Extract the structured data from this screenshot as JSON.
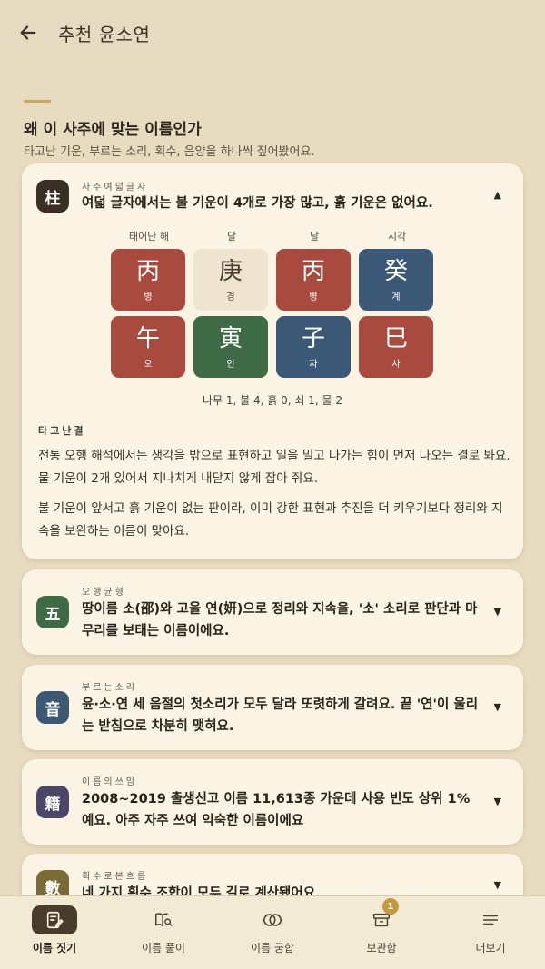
{
  "header": {
    "title": "추천 윤소연"
  },
  "section": {
    "title": "왜 이 사주에 맞는 이름인가",
    "subtitle": "타고난 기운, 부르는 소리, 획수, 음양을 하나씩 짚어봤어요."
  },
  "saju_card": {
    "badge": "柱",
    "overline": "사주여덟글자",
    "headline": "여덟 글자에서는 불 기운이 4개로 가장 많고, 흙 기운은 없어요.",
    "chevron": "▲",
    "columns": [
      "태어난 해",
      "달",
      "날",
      "시각"
    ],
    "top_row": [
      {
        "han": "丙",
        "reading": "병",
        "element": "fire"
      },
      {
        "han": "庚",
        "reading": "경",
        "element": "metal"
      },
      {
        "han": "丙",
        "reading": "병",
        "element": "fire"
      },
      {
        "han": "癸",
        "reading": "계",
        "element": "water"
      }
    ],
    "bottom_row": [
      {
        "han": "午",
        "reading": "오",
        "element": "fire"
      },
      {
        "han": "寅",
        "reading": "인",
        "element": "wood"
      },
      {
        "han": "子",
        "reading": "자",
        "element": "water"
      },
      {
        "han": "巳",
        "reading": "사",
        "element": "fire"
      }
    ],
    "counts": "나무 1, 불 4, 흙 0, 쇠 1, 물 2",
    "temperament_label": "타고난결",
    "paragraph1": "전통 오행 해석에서는 생각을 밖으로 표현하고 일을 밀고 나가는 힘이 먼저 나오는 결로 봐요. 물 기운이 2개 있어서 지나치게 내닫지 않게 잡아 줘요.",
    "paragraph2": "불 기운이 앞서고 흙 기운이 없는 판이라, 이미 강한 표현과 추진을 더 키우기보다 정리와 지속을 보완하는 이름이 맞아요."
  },
  "cards": [
    {
      "badge": "五",
      "overline": "오행균형",
      "headline": "땅이름 소(邵)와 고울 연(姸)으로 정리와 지속을, '소' 소리로 판단과 마무리를 보태는 이름이에요.",
      "chevron": "▼",
      "color": "#3e6b46"
    },
    {
      "badge": "音",
      "overline": "부르는소리",
      "headline": "윤·소·연 세 음절의 첫소리가 모두 달라 또렷하게 갈려요. 끝 '연'이 울리는 받침으로 차분히 맺혀요.",
      "chevron": "▼",
      "color": "#3c5873"
    },
    {
      "badge": "籍",
      "overline": "이름의쓰임",
      "headline": "2008~2019 출생신고 이름 11,613종 가운데 사용 빈도 상위 1%예요. 아주 자주 쓰여 익숙한 이름이에요",
      "chevron": "▼",
      "color": "#4b4568"
    },
    {
      "badge": "數",
      "overline": "획수로본흐름",
      "headline": "네 가지 획수 조합이 모두 길로 계산됐어요.",
      "chevron": "▼",
      "color": "#7a6a35"
    }
  ],
  "element_colors": {
    "fire": "#a84a3e",
    "metal": "#efe4cf",
    "water": "#3b5876",
    "wood": "#3e6b46"
  },
  "nav": {
    "items": [
      {
        "label": "이름 짓기",
        "icon": "edit-note-icon",
        "active": true
      },
      {
        "label": "이름 풀이",
        "icon": "book-search-icon"
      },
      {
        "label": "이름 궁합",
        "icon": "rings-icon"
      },
      {
        "label": "보관함",
        "icon": "archive-box-icon",
        "badge": "1"
      },
      {
        "label": "더보기",
        "icon": "menu-icon"
      }
    ]
  }
}
